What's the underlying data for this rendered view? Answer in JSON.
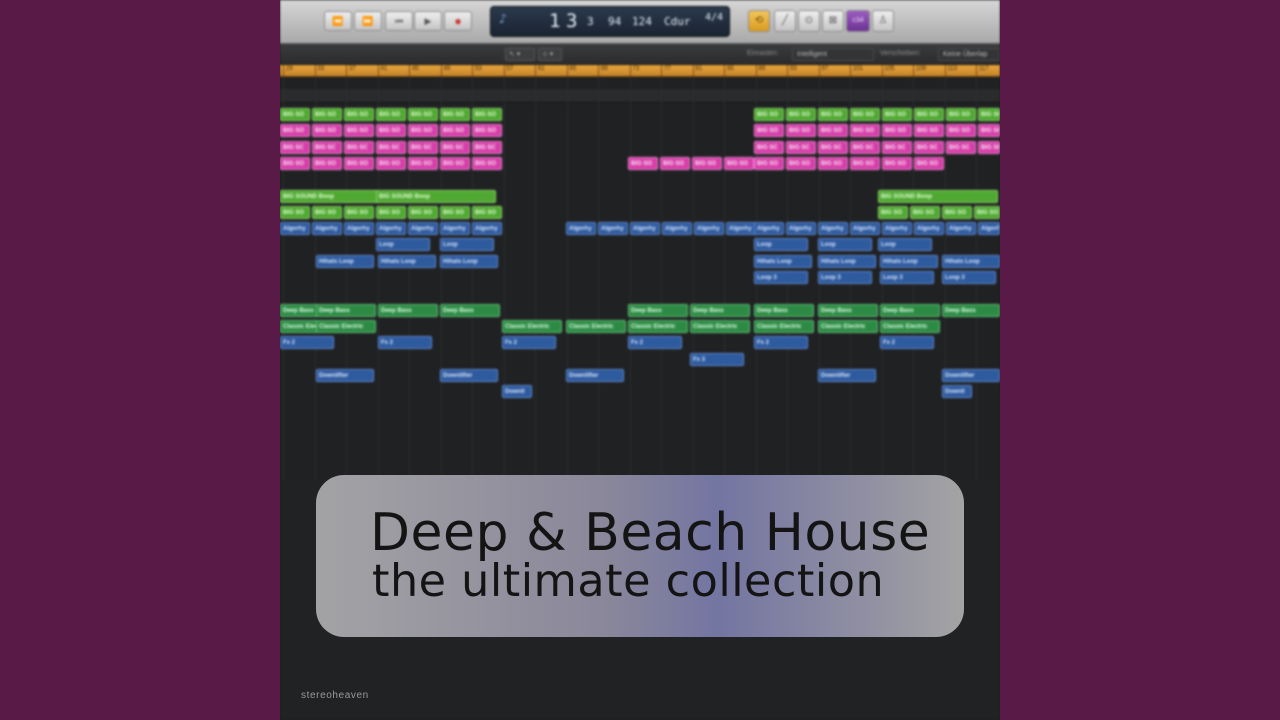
{
  "album": {
    "title_line1": "Deep & Beach House",
    "title_line2": "the ultimate collection",
    "label": "stereoheaven"
  },
  "colors": {
    "background": "#5a1a48",
    "pink_region": "#d63ea9",
    "lime_region": "#4fa832",
    "green_region": "#2d8a44",
    "blue_region": "#2e5a9e",
    "ruler": "#e7a63c"
  },
  "control_bar": {
    "transport": [
      "⏪",
      "⏩",
      "⏮",
      "▶",
      "●"
    ],
    "lcd": {
      "bar": "1",
      "beat": "3",
      "div": "3",
      "tick": "94",
      "tempo": "124",
      "key": "Cdur",
      "signature": "4/4"
    },
    "right_buttons": [
      "⟲",
      "╱",
      "⊙",
      "⊠",
      "c34",
      "♙"
    ]
  },
  "edit_bar": {
    "tool": "↖ ▾",
    "tool2": "⊹ ▾",
    "snap_label": "Einrasten:",
    "snap_value": "Intelligent",
    "drag_label": "Verschieben:",
    "drag_value": "Keine Überlap"
  },
  "ruler": {
    "bars": [
      "29",
      "33",
      "37",
      "41",
      "45",
      "49",
      "53",
      "57",
      "61",
      "65",
      "69",
      "73",
      "77",
      "81",
      "85",
      "89",
      "93",
      "97",
      "101",
      "105",
      "109",
      "113",
      "117"
    ]
  },
  "regions": [
    {
      "c": "lime",
      "l": "BIG SO",
      "row": 0,
      "xs": [
        0,
        32,
        64,
        96,
        128,
        160,
        192,
        474,
        506,
        538,
        570,
        602,
        634,
        666,
        698
      ]
    },
    {
      "c": "pink",
      "l": "BIG SO",
      "row": 1,
      "xs": [
        0,
        32,
        64,
        96,
        128,
        160,
        192,
        474,
        506,
        538,
        570,
        602,
        634,
        666,
        698
      ]
    },
    {
      "c": "pink",
      "l": "BIG SC",
      "row": 2,
      "xs": [
        0,
        32,
        64,
        96,
        128,
        160,
        192,
        474,
        506,
        538,
        570,
        602,
        634,
        666,
        698
      ]
    },
    {
      "c": "pink",
      "l": "BIG SO",
      "row": 3,
      "xs": [
        0,
        32,
        64,
        96,
        128,
        160,
        192,
        348,
        380,
        412,
        444,
        474,
        506,
        538,
        570,
        602,
        634
      ]
    },
    {
      "c": "lime",
      "l": "BIG SOUND Boop",
      "row": 5,
      "xs": [
        0,
        96,
        598
      ]
    },
    {
      "c": "lime",
      "l": "BIG SO",
      "row": 6,
      "xs": [
        0,
        32,
        64,
        96,
        128,
        160,
        192,
        598,
        630,
        662,
        694
      ]
    },
    {
      "c": "blue",
      "l": "Algorhy",
      "row": 7,
      "xs": [
        0,
        32,
        64,
        96,
        128,
        160,
        192,
        286,
        318,
        350,
        382,
        414,
        446,
        474,
        506,
        538,
        570,
        602,
        634,
        666,
        698
      ]
    },
    {
      "c": "blue",
      "l": "Loop",
      "row": 8,
      "xs": [
        96,
        160,
        474,
        538,
        598
      ]
    },
    {
      "c": "blue",
      "l": "Hihats Loop",
      "row": 9,
      "xs": [
        36,
        98,
        160,
        474,
        538,
        600,
        662
      ]
    },
    {
      "c": "blue",
      "l": "Loop 3",
      "row": 10,
      "xs": [
        474,
        538,
        600,
        662
      ]
    },
    {
      "c": "green",
      "l": "Deep Bass",
      "row": 12,
      "xs": [
        0,
        36,
        98,
        160,
        348,
        410,
        474,
        538,
        600,
        662
      ]
    },
    {
      "c": "green",
      "l": "Classic Electric",
      "row": 13,
      "xs": [
        0,
        36,
        222,
        286,
        348,
        410,
        474,
        538,
        600
      ]
    },
    {
      "c": "blue",
      "l": "Fx 2",
      "row": 14,
      "xs": [
        0,
        98,
        222,
        348,
        474,
        600
      ]
    },
    {
      "c": "blue",
      "l": "Fx 3",
      "row": 15,
      "xs": [
        410
      ]
    },
    {
      "c": "blue",
      "l": "Downlifter",
      "row": 16,
      "xs": [
        36,
        160,
        286,
        538,
        662
      ]
    },
    {
      "c": "blue",
      "l": "Downli",
      "row": 17,
      "xs": [
        222,
        662
      ]
    }
  ]
}
